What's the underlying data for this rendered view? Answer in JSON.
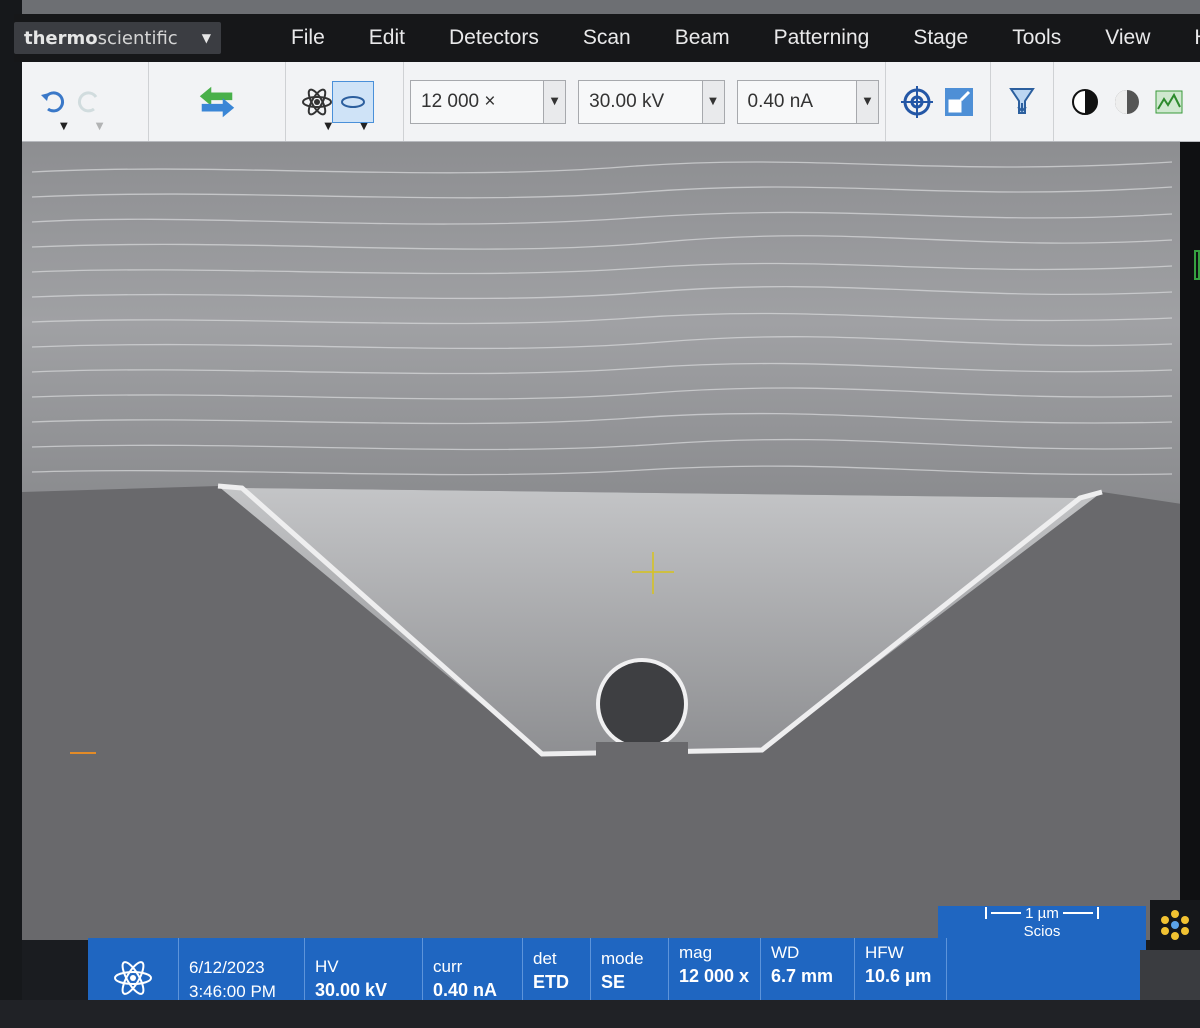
{
  "app": {
    "brand_bold": "thermo",
    "brand_light": "scientific",
    "menu": [
      "File",
      "Edit",
      "Detectors",
      "Scan",
      "Beam",
      "Patterning",
      "Stage",
      "Tools",
      "View",
      "Help"
    ]
  },
  "toolbar": {
    "magnification": "12 000 ×",
    "high_voltage": "30.00 kV",
    "current": "0.40 nA"
  },
  "status": {
    "date": "6/12/2023",
    "time": "3:46:00 PM",
    "cells": [
      {
        "label": "HV",
        "value": "30.00 kV"
      },
      {
        "label": "curr",
        "value": "0.40 nA"
      },
      {
        "label": "det",
        "value": "ETD"
      },
      {
        "label": "mode",
        "value": "SE"
      },
      {
        "label": "mag",
        "value": "12 000 x"
      },
      {
        "label": "WD",
        "value": "6.7 mm"
      },
      {
        "label": "HFW",
        "value": "10.6 µm"
      }
    ],
    "scale": "1 µm",
    "instrument": "Scios"
  },
  "colors": {
    "status_blue": "#1f66c1",
    "crosshair": "#d8c31c",
    "toolbar_bg": "#f2f3f5"
  }
}
